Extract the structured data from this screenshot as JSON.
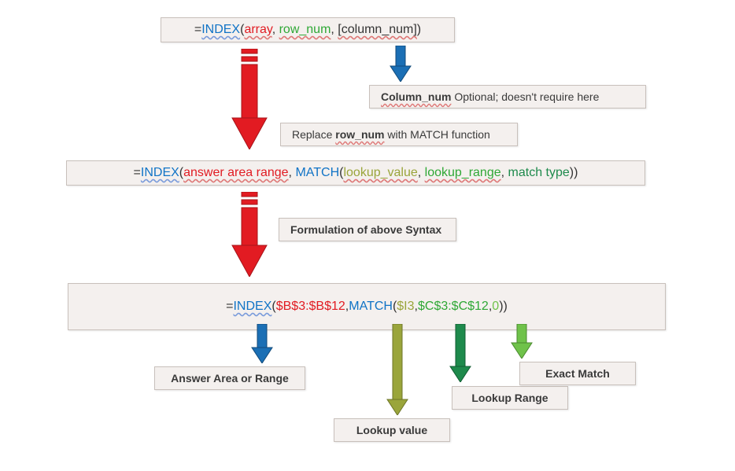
{
  "formula1": {
    "eq": "=",
    "func": "INDEX",
    "open": "(",
    "arg1": "array",
    "sep1": ", ",
    "arg2": "row_num",
    "sep2": ", ",
    "arg3": "[column_num]",
    "close": ")"
  },
  "label_column": {
    "bold": "Column_num",
    "rest": " Optional; doesn't require here"
  },
  "label_replace": {
    "pre": "Replace ",
    "bold": "row_num",
    "post": " with MATCH function"
  },
  "formula2": {
    "eq": "=",
    "func": "INDEX",
    "open": "(",
    "arg1": "answer area range",
    "sep1": ", ",
    "match": "MATCH",
    "mopen": "(",
    "marg1": "lookup_value",
    "msep1": ", ",
    "marg2": "lookup_range",
    "msep2": ", ",
    "marg3": "match type",
    "mclose": ")",
    "close": ")"
  },
  "label_formulation": "Formulation of above Syntax",
  "formula3": {
    "eq": "=",
    "func": "INDEX",
    "open": "(",
    "arg1": "$B$3:$B$12",
    "sep1": ",",
    "match": "MATCH",
    "mopen": "(",
    "marg1": "$I3",
    "msep1": ",",
    "marg2": "$C$3:$C$12",
    "msep2": ",",
    "marg3": "0",
    "mclose": ")",
    "close": ")"
  },
  "label_answer": "Answer Area or Range",
  "label_lookup_value": "Lookup value",
  "label_lookup_range": "Lookup Range",
  "label_exact": "Exact Match"
}
